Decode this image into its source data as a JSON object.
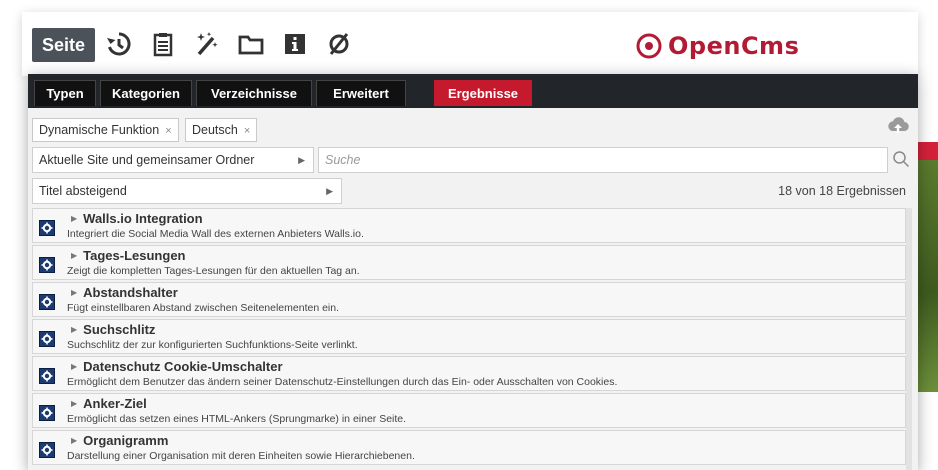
{
  "toolbar": {
    "seite_label": "Seite",
    "icons": [
      "history-icon",
      "clipboard-icon",
      "magic-wand-icon",
      "folder-icon",
      "info-icon",
      "disabled-icon"
    ],
    "logo_text": "OpenCms",
    "logo_color": "#b31b34"
  },
  "tabs": [
    {
      "label": "Typen"
    },
    {
      "label": "Kategorien"
    },
    {
      "label": "Verzeichnisse"
    },
    {
      "label": "Erweitert"
    },
    {
      "label": "Ergebnisse",
      "active": true
    }
  ],
  "filters": [
    {
      "label": "Dynamische Funktion",
      "remove": "×"
    },
    {
      "label": "Deutsch",
      "remove": "×"
    }
  ],
  "scope_select": {
    "value": "Aktuelle Site und gemeinsamer Ordner"
  },
  "search": {
    "placeholder": "Suche"
  },
  "sort_select": {
    "value": "Titel absteigend"
  },
  "result_count": "18 von 18 Ergebnissen",
  "results": [
    {
      "title": "Walls.io Integration",
      "desc": "Integriert die Social Media Wall des externen Anbieters Walls.io."
    },
    {
      "title": "Tages-Lesungen",
      "desc": "Zeigt die kompletten Tages-Lesungen für den aktuellen Tag an."
    },
    {
      "title": "Abstandshalter",
      "desc": "Fügt einstellbaren Abstand zwischen Seitenelementen ein."
    },
    {
      "title": "Suchschlitz",
      "desc": "Suchschlitz der zur konfigurierten Suchfunktions-Seite verlinkt."
    },
    {
      "title": "Datenschutz Cookie-Umschalter",
      "desc": "Ermöglicht dem Benutzer das ändern seiner Datenschutz-Einstellungen durch das Ein- oder Ausschalten von Cookies."
    },
    {
      "title": "Anker-Ziel",
      "desc": "Ermöglicht das setzen eines HTML-Ankers (Sprungmarke) in einer Seite."
    },
    {
      "title": "Organigramm",
      "desc": "Darstellung einer Organisation mit deren Einheiten sowie Hierarchiebenen."
    }
  ],
  "colors": {
    "accent": "#c5192d",
    "tabbar": "#22262a",
    "function_icon": "#1d3b73"
  }
}
